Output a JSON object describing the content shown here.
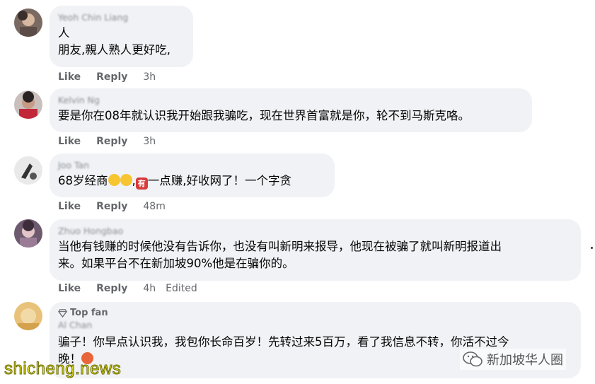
{
  "comments": [
    {
      "name": "Yeoh Chin Liang",
      "lines": [
        "人",
        "朋友,親人熟人更好吃,"
      ],
      "like": "Like",
      "reply": "Reply",
      "time": "3h"
    },
    {
      "name": "Kelvin Ng",
      "lines": [
        "要是你在08年就认识我开始跟我骗吃，现在世界首富就是你，轮不到马斯克咯。"
      ],
      "like": "Like",
      "reply": "Reply",
      "time": "3h"
    },
    {
      "name": "Joo Tan",
      "text_prefix": "68岁经商",
      "text_mid": ",",
      "badge": "有",
      "text_suffix": "一点赚,好收网了！一个字贪",
      "like": "Like",
      "reply": "Reply",
      "time": "48m"
    },
    {
      "name": "Zhuo Hongbao",
      "lines": [
        "当他有钱赚的时候他没有告诉你，也没有叫新明来报导，他现在被骗了就叫新明报道出",
        "来。如果平台不在新加坡90%他是在骗你的。"
      ],
      "like": "Like",
      "reply": "Reply",
      "time": "4h",
      "edited": "Edited"
    },
    {
      "top_fan": "Top fan",
      "name": "Al Chan",
      "lines": [
        "骗子！你早点认识我，我包你长命百岁！先转过来5百万，看了我信息不转，你活不过今",
        "晚！"
      ]
    }
  ],
  "watermark": {
    "left": "shicheng.news",
    "right": "新加坡华人圈"
  },
  "colors": {
    "bubble": "#f0f2f5",
    "action_text": "#65676b",
    "watermark_yellow": "#e6e622"
  }
}
